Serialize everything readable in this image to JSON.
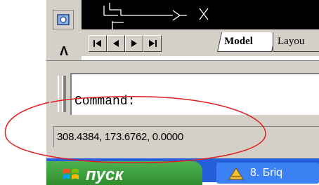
{
  "layout_tabs": {
    "model": "Model",
    "layout": "Layou"
  },
  "nav_buttons": [
    "first-tab",
    "previous-tab",
    "next-tab",
    "last-tab"
  ],
  "command": {
    "prompt": "Command:"
  },
  "status_bar": {
    "coordinates": "308.4384, 173.6762, 0.0000"
  },
  "taskbar": {
    "start_label": "пуск",
    "task_label": "8. Бriq"
  },
  "colors": {
    "annotation": "#e02020",
    "window_face": "#d4d0c8",
    "canvas": "#000000",
    "taskbar": "#245edb",
    "start_button": "#3a9c3a"
  }
}
